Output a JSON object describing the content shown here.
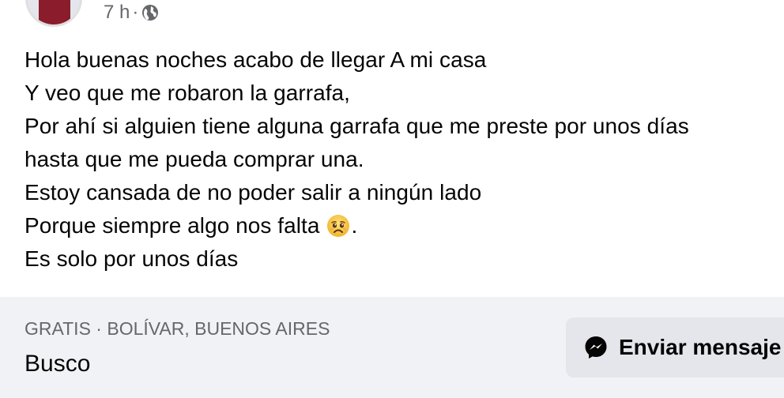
{
  "post": {
    "time": "7 h",
    "separator": "·",
    "privacy_icon": "globe-icon",
    "lines": [
      "Hola buenas noches acabo de llegar A mi casa",
      "Y veo que me robaron la garrafa,",
      "Por ahí si alguien tiene alguna garrafa que me preste por unos días",
      "hasta que me pueda comprar una.",
      "Estoy cansada de no poder salir a ningún lado",
      "Porque siempre algo nos falta",
      "Es solo por unos días"
    ],
    "emoji_icon": "sad-face-emoji-icon",
    "emoji_trailing_text": "."
  },
  "listing": {
    "meta": "GRATIS · BOLÍVAR, BUENOS AIRES",
    "title": "Busco",
    "send_button_label": "Enviar mensaje",
    "send_button_icon": "messenger-icon"
  },
  "colors": {
    "text_primary": "#050505",
    "text_secondary": "#65676b",
    "footer_background": "#f0f2f5",
    "button_background": "#e4e6eb"
  }
}
